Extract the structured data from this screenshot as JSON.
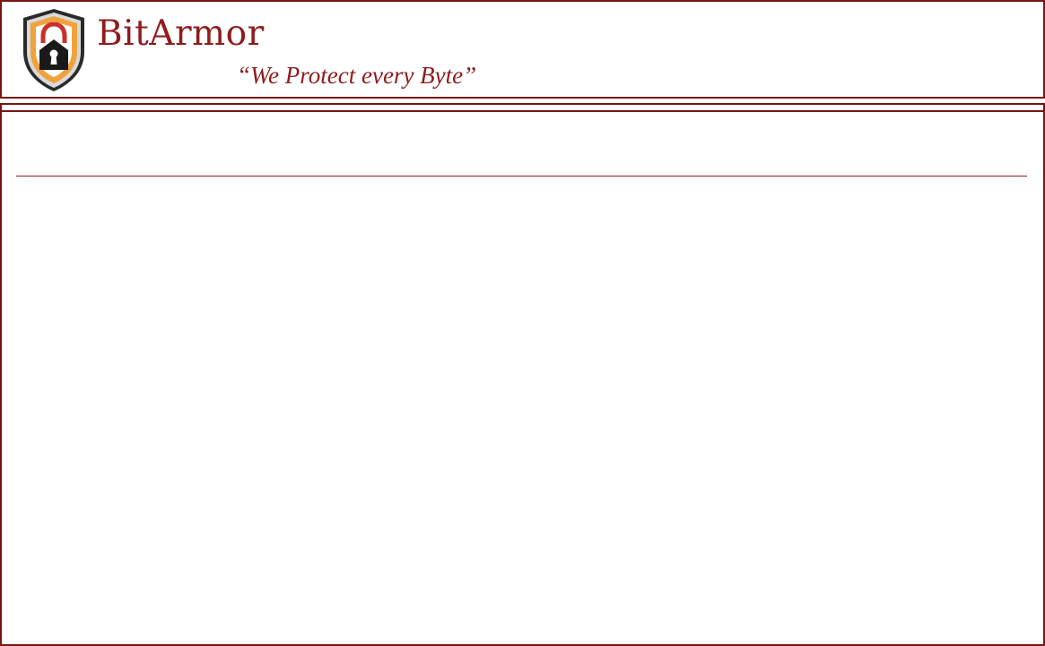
{
  "header": {
    "brand_name": "BitArmor",
    "tagline": "“We Protect every Byte”",
    "logo_icon": "shield-lock-icon"
  },
  "colors": {
    "brand": "#8f1c1c",
    "border": "#7a1414",
    "shield_orange": "#f0a33a",
    "shield_dark": "#1a1a1a"
  }
}
